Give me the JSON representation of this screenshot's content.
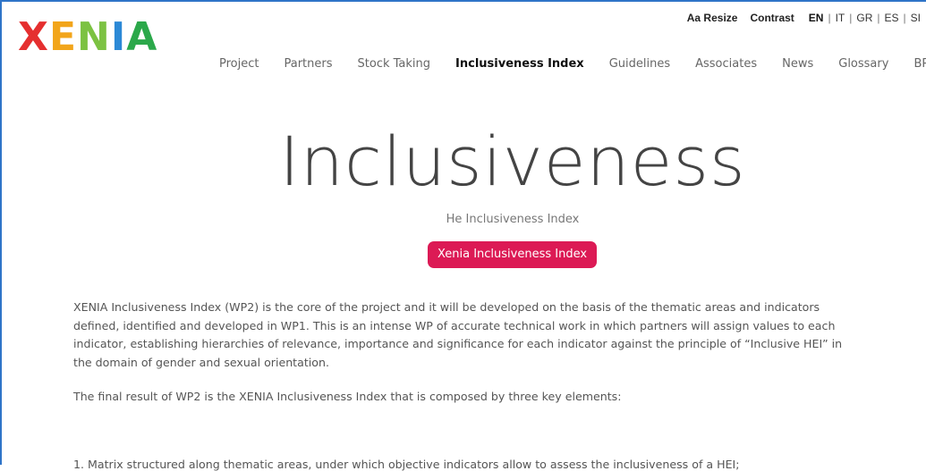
{
  "brand": {
    "letters": [
      {
        "char": "X",
        "color": "#e52f2f"
      },
      {
        "char": "E",
        "color": "#f2a51a"
      },
      {
        "char": "N",
        "color": "#7cc242"
      },
      {
        "char": "I",
        "color": "#2c89d6"
      },
      {
        "char": "A",
        "color": "#2ba84a"
      }
    ]
  },
  "utility": {
    "resize_label": "Aa Resize",
    "contrast_label": "Contrast",
    "languages": [
      "EN",
      "IT",
      "GR",
      "ES",
      "SI"
    ],
    "active_language": "EN"
  },
  "nav": {
    "items": [
      {
        "label": "Project"
      },
      {
        "label": "Partners"
      },
      {
        "label": "Stock Taking"
      },
      {
        "label": "Inclusiveness Index",
        "active": true
      },
      {
        "label": "Guidelines"
      },
      {
        "label": "Associates"
      },
      {
        "label": "News"
      },
      {
        "label": "Glossary"
      },
      {
        "label": "BP"
      }
    ]
  },
  "hero": {
    "title": "Inclusiveness",
    "subtitle": "He Inclusiveness Index",
    "button_label": "Xenia Inclusiveness Index",
    "button_color": "#dc1a55"
  },
  "content": {
    "paragraph1_lines": [
      "XENIA Inclusiveness Index (WP2) is the core of the project and it will be developed on the basis of the thematic areas and indicators",
      "defined, identified and developed in WP1. This is an intense WP of accurate technical work in which partners will assign values to each",
      "indicator, establishing hierarchies of relevance, importance and significance for each indicator against the principle of “Inclusive HEI” in",
      "the domain of gender and sexual orientation."
    ],
    "paragraph2": "The final result of WP2 is the XENIA Inclusiveness Index that is composed by three key elements:",
    "list_item_1": "1. Matrix structured along thematic areas, under which objective indicators allow to assess the inclusiveness of a HEI;"
  }
}
